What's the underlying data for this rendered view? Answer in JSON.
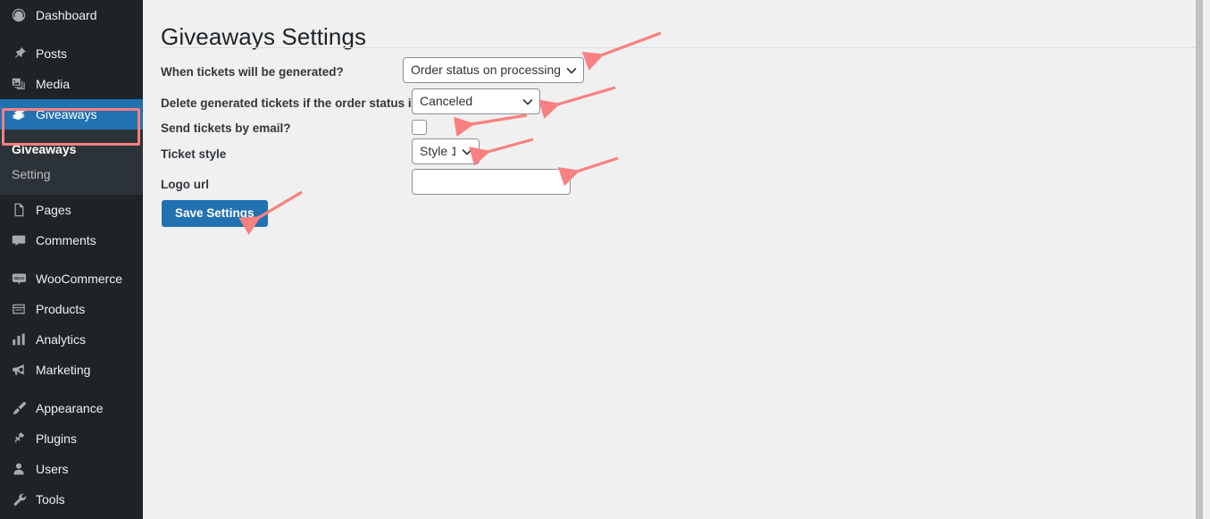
{
  "sidebar": {
    "items": [
      {
        "label": "Dashboard",
        "icon": "dashboard-icon",
        "current": false,
        "gap_before": false
      },
      {
        "label": "Posts",
        "icon": "pin-icon",
        "current": false,
        "gap_before": true
      },
      {
        "label": "Media",
        "icon": "media-icon",
        "current": false,
        "gap_before": false
      },
      {
        "label": "Giveaways",
        "icon": "tickets-icon",
        "current": true,
        "gap_before": false
      },
      {
        "label": "Pages",
        "icon": "pages-icon",
        "current": false,
        "gap_before": false
      },
      {
        "label": "Comments",
        "icon": "comments-icon",
        "current": false,
        "gap_before": false
      },
      {
        "label": "WooCommerce",
        "icon": "woocommerce-icon",
        "current": false,
        "gap_before": true
      },
      {
        "label": "Products",
        "icon": "products-icon",
        "current": false,
        "gap_before": false
      },
      {
        "label": "Analytics",
        "icon": "analytics-icon",
        "current": false,
        "gap_before": false
      },
      {
        "label": "Marketing",
        "icon": "megaphone-icon",
        "current": false,
        "gap_before": false
      },
      {
        "label": "Appearance",
        "icon": "paintbrush-icon",
        "current": false,
        "gap_before": true
      },
      {
        "label": "Plugins",
        "icon": "plug-icon",
        "current": false,
        "gap_before": false
      },
      {
        "label": "Users",
        "icon": "user-icon",
        "current": false,
        "gap_before": false
      },
      {
        "label": "Tools",
        "icon": "wrench-icon",
        "current": false,
        "gap_before": false
      }
    ],
    "submenu": {
      "items": [
        {
          "label": "Giveaways",
          "current": true
        },
        {
          "label": "Setting",
          "current": false
        }
      ]
    },
    "colors": {
      "background": "#1d2327",
      "submenu_background": "#2c3338",
      "current_item": "#2271b1",
      "text": "#f0f0f1",
      "muted_text": "#b9bdc1"
    }
  },
  "main": {
    "title": "Giveaways Settings",
    "fields": {
      "when_generated": {
        "label": "When tickets will be generated?",
        "value": "Order status on processing",
        "options": [
          "Order status on processing"
        ]
      },
      "delete_on_status": {
        "label": "Delete generated tickets if the order status is",
        "value": "Canceled",
        "options": [
          "Canceled"
        ]
      },
      "send_by_email": {
        "label": "Send tickets by email?",
        "checked": false
      },
      "ticket_style": {
        "label": "Ticket style",
        "value": "Style 1",
        "options": [
          "Style 1"
        ]
      },
      "logo_url": {
        "label": "Logo url",
        "value": "",
        "placeholder": ""
      }
    },
    "save_button": {
      "label": "Save Settings",
      "color": "#2271b1"
    }
  },
  "annotations": {
    "color": "#f98080",
    "highlight_box_target": "Giveaways",
    "arrow_targets": [
      "when-generated-select",
      "delete-on-status-select",
      "send-by-email-checkbox",
      "ticket-style-select",
      "logo-url-input",
      "save-settings-button"
    ]
  }
}
